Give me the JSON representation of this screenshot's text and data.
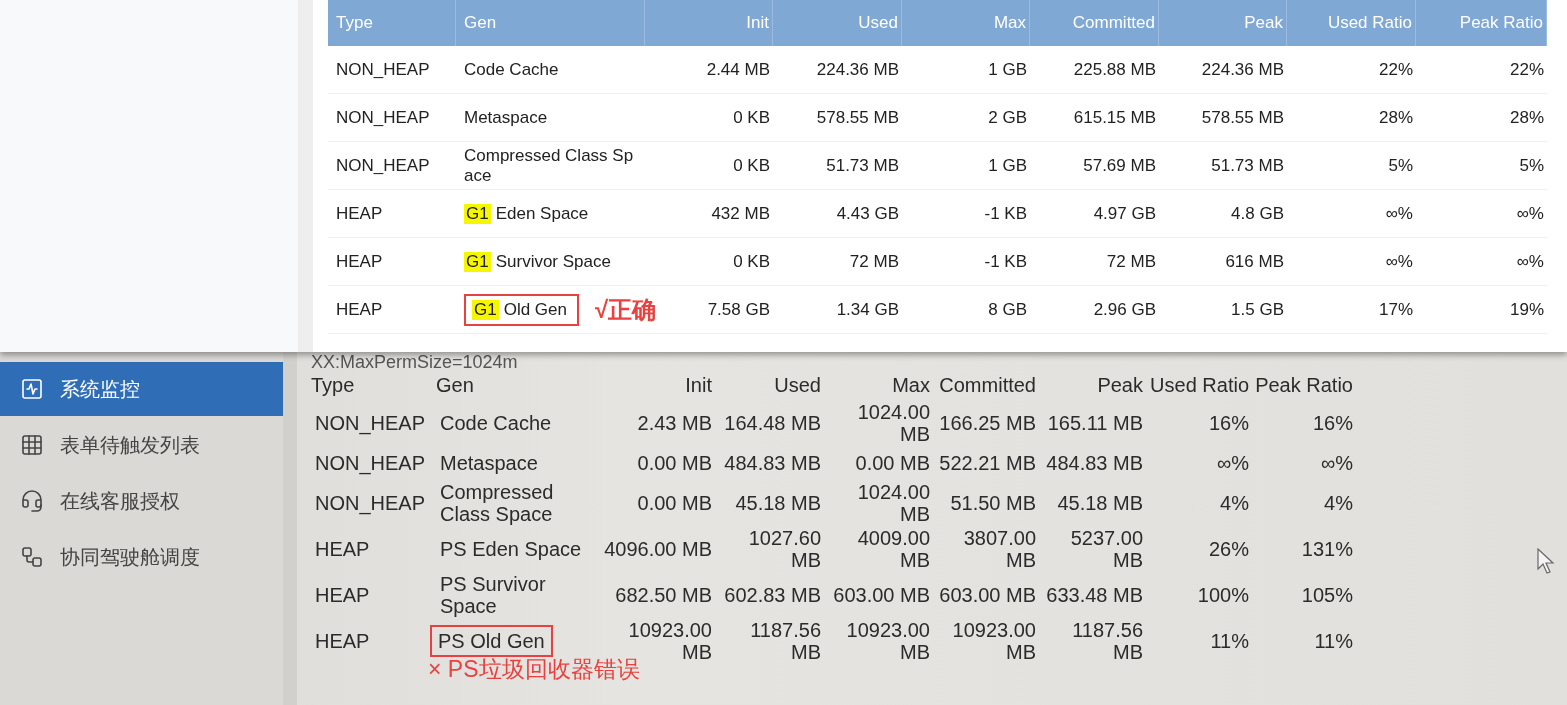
{
  "top_table": {
    "columns": [
      "Type",
      "Gen",
      "Init",
      "Used",
      "Max",
      "Committed",
      "Peak",
      "Used Ratio",
      "Peak Ratio"
    ],
    "rows": [
      {
        "type": "NON_HEAP",
        "gen": "Code Cache",
        "values": [
          "2.44 MB",
          "224.36 MB",
          "1 GB",
          "225.88 MB",
          "224.36 MB",
          "22%",
          "22%"
        ],
        "boxed": false
      },
      {
        "type": "NON_HEAP",
        "gen": "Metaspace",
        "values": [
          "0 KB",
          "578.55 MB",
          "2 GB",
          "615.15 MB",
          "578.55 MB",
          "28%",
          "28%"
        ],
        "boxed": false
      },
      {
        "type": "NON_HEAP",
        "gen": "Compressed Class Space",
        "values": [
          "0 KB",
          "51.73 MB",
          "1 GB",
          "57.69 MB",
          "51.73 MB",
          "5%",
          "5%"
        ],
        "boxed": false
      },
      {
        "type": "HEAP",
        "gen_tag": "G1",
        "gen": "Eden Space",
        "values": [
          "432 MB",
          "4.43 GB",
          "-1 KB",
          "4.97 GB",
          "4.8 GB",
          "∞%",
          "∞%"
        ],
        "boxed": false
      },
      {
        "type": "HEAP",
        "gen_tag": "G1",
        "gen": "Survivor Space",
        "values": [
          "0 KB",
          "72 MB",
          "-1 KB",
          "72 MB",
          "616 MB",
          "∞%",
          "∞%"
        ],
        "boxed": false
      },
      {
        "type": "HEAP",
        "gen_tag": "G1",
        "gen": "Old Gen",
        "values": [
          "7.58 GB",
          "1.34 GB",
          "8 GB",
          "2.96 GB",
          "1.5 GB",
          "17%",
          "19%"
        ],
        "boxed": true,
        "note": "√正确"
      }
    ]
  },
  "sidebar": {
    "items": [
      {
        "label": "系统监控",
        "selected": true
      },
      {
        "label": "表单待触发列表",
        "selected": false
      },
      {
        "label": "在线客服授权",
        "selected": false
      },
      {
        "label": "协同驾驶舱调度",
        "selected": false
      }
    ]
  },
  "bottom_table": {
    "cut_line": "XX:MaxPermSize=1024m",
    "columns": [
      "Type",
      "Gen",
      "Init",
      "Used",
      "Max",
      "Committed",
      "Peak",
      "Used Ratio",
      "Peak Ratio"
    ],
    "rows": [
      {
        "type": "NON_HEAP",
        "gen": "Code Cache",
        "values": [
          "2.43 MB",
          "164.48 MB",
          "1024.00 MB",
          "166.25 MB",
          "165.11 MB",
          "16%",
          "16%"
        ],
        "boxed": false
      },
      {
        "type": "NON_HEAP",
        "gen": "Metaspace",
        "values": [
          "0.00 MB",
          "484.83 MB",
          "0.00 MB",
          "522.21 MB",
          "484.83 MB",
          "∞%",
          "∞%"
        ],
        "boxed": false
      },
      {
        "type": "NON_HEAP",
        "gen": "Compressed Class Space",
        "values": [
          "0.00 MB",
          "45.18 MB",
          "1024.00 MB",
          "51.50 MB",
          "45.18 MB",
          "4%",
          "4%"
        ],
        "boxed": false
      },
      {
        "type": "HEAP",
        "gen": "PS Eden Space",
        "values": [
          "4096.00 MB",
          "1027.60 MB",
          "4009.00 MB",
          "3807.00 MB",
          "5237.00 MB",
          "26%",
          "131%"
        ],
        "boxed": false
      },
      {
        "type": "HEAP",
        "gen": "PS Survivor Space",
        "values": [
          "682.50 MB",
          "602.83 MB",
          "603.00 MB",
          "603.00 MB",
          "633.48 MB",
          "100%",
          "105%"
        ],
        "boxed": false
      },
      {
        "type": "HEAP",
        "gen": "PS Old Gen",
        "values": [
          "10923.00 MB",
          "1187.56 MB",
          "10923.00 MB",
          "10923.00 MB",
          "1187.56 MB",
          "11%",
          "11%"
        ],
        "boxed": true,
        "note": "× PS垃圾回收器错误"
      }
    ]
  }
}
